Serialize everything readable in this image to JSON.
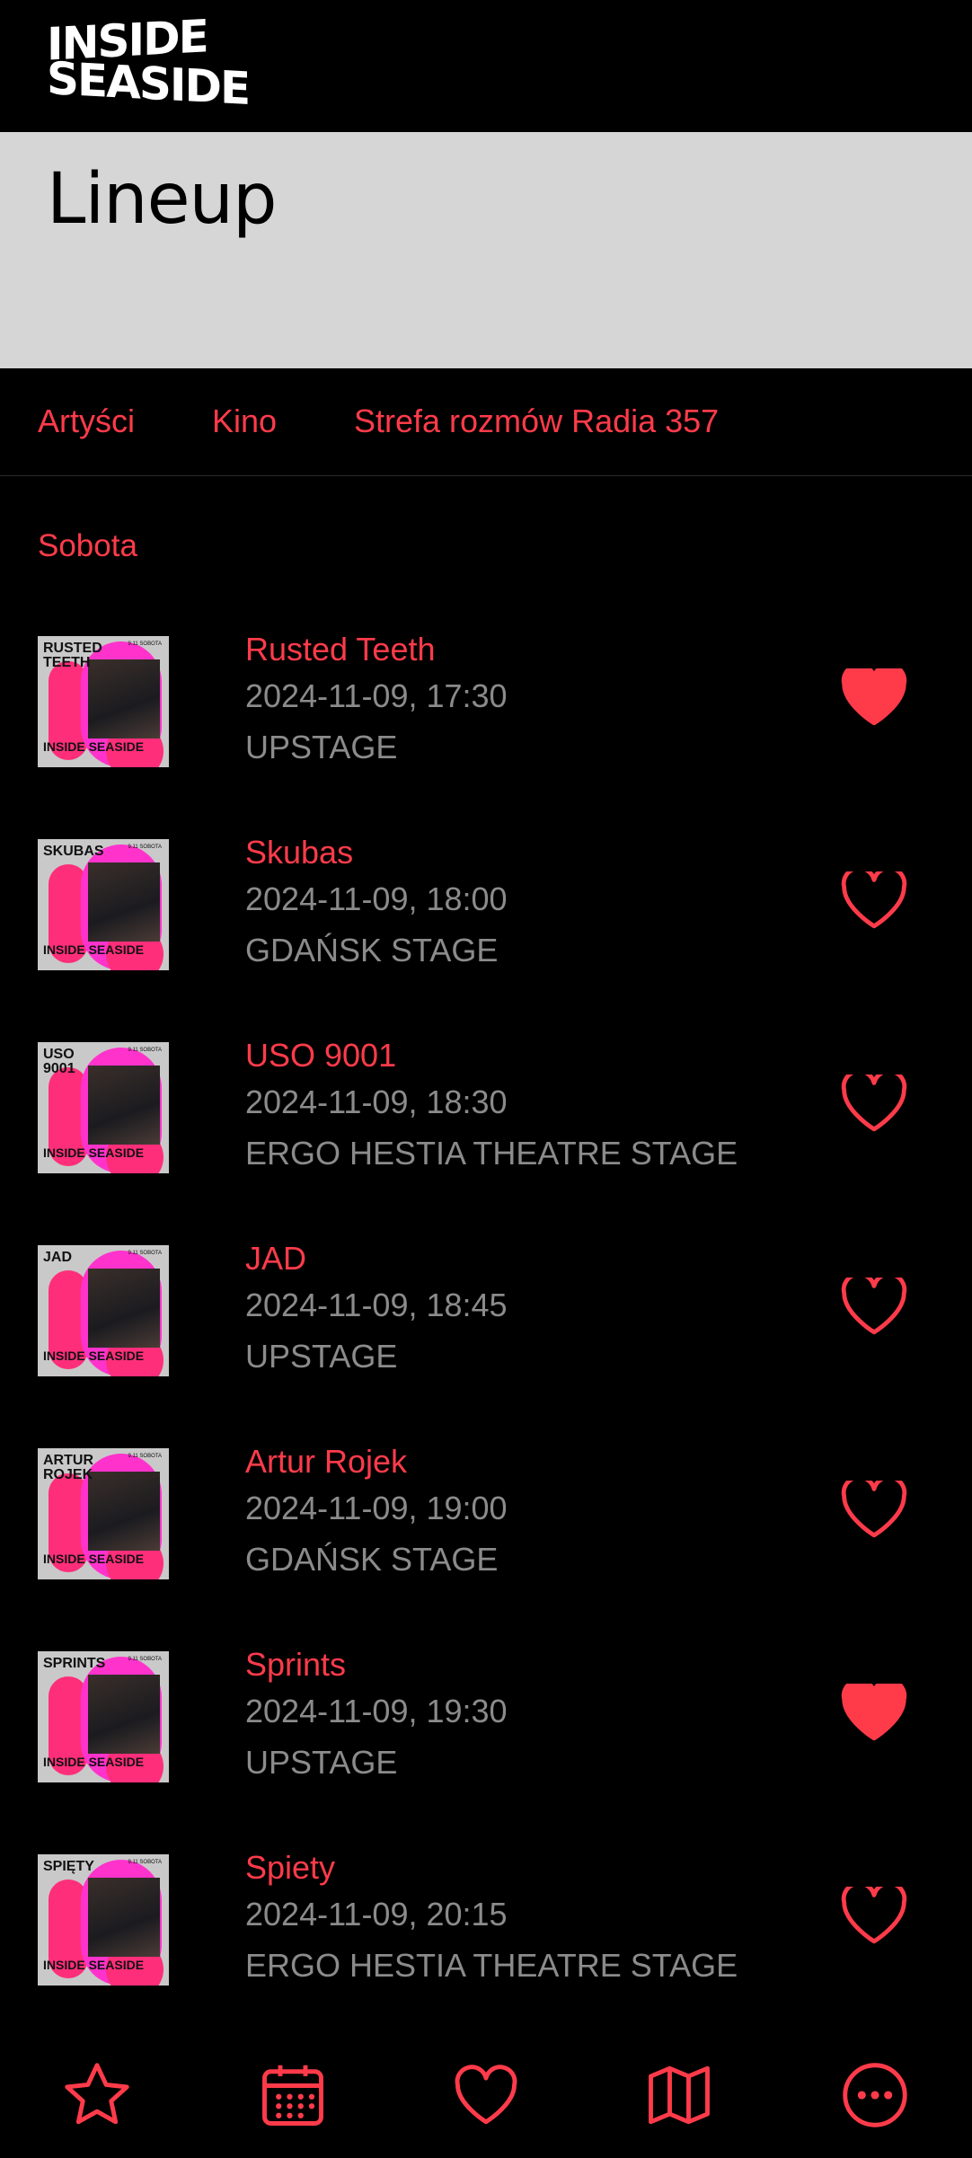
{
  "header": {
    "logo_line1": "INSIDE",
    "logo_line2": "SEASIDE"
  },
  "page": {
    "title": "Lineup"
  },
  "tabs": [
    "Artyści",
    "Kino",
    "Strefa rozmów Radia 357"
  ],
  "day_label": "Sobota",
  "events": [
    {
      "name": "Rusted Teeth",
      "datetime": "2024-11-09, 17:30",
      "stage": "UPSTAGE",
      "thumb_label": "RUSTED TEETH",
      "favorite": true
    },
    {
      "name": "Skubas",
      "datetime": "2024-11-09, 18:00",
      "stage": "GDAŃSK STAGE",
      "thumb_label": "SKUBAS",
      "favorite": false
    },
    {
      "name": "USO 9001",
      "datetime": "2024-11-09, 18:30",
      "stage": "ERGO HESTIA THEATRE STAGE",
      "thumb_label": "USO 9001",
      "favorite": false
    },
    {
      "name": "JAD",
      "datetime": "2024-11-09, 18:45",
      "stage": "UPSTAGE",
      "thumb_label": "JAD",
      "favorite": false
    },
    {
      "name": "Artur Rojek",
      "datetime": "2024-11-09, 19:00",
      "stage": "GDAŃSK STAGE",
      "thumb_label": "ARTUR ROJEK",
      "favorite": false
    },
    {
      "name": "Sprints",
      "datetime": "2024-11-09, 19:30",
      "stage": "UPSTAGE",
      "thumb_label": "SPRINTS",
      "favorite": true
    },
    {
      "name": "Spiety",
      "datetime": "2024-11-09, 20:15",
      "stage": "ERGO HESTIA THEATRE STAGE",
      "thumb_label": "SPIĘTY",
      "favorite": false
    }
  ],
  "thumb": {
    "date_text": "9.11 SOBOTA",
    "logo_text": "INSIDE SEASIDE"
  },
  "bottom_nav": [
    {
      "icon": "star-icon"
    },
    {
      "icon": "calendar-icon"
    },
    {
      "icon": "heart-icon"
    },
    {
      "icon": "map-icon"
    },
    {
      "icon": "more-icon"
    }
  ],
  "colors": {
    "accent": "#ff3b4a",
    "secondary_text": "#8b8b8b",
    "hero_bg": "#d6d6d6",
    "background": "#000000"
  }
}
